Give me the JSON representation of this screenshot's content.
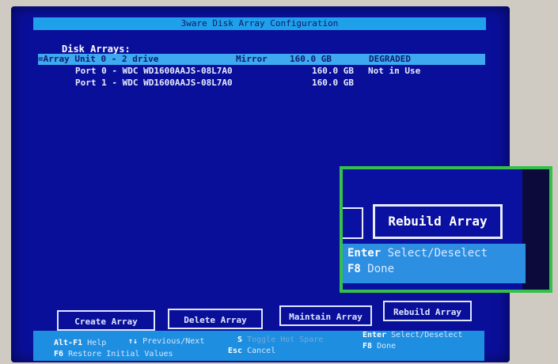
{
  "window": {
    "title": "3ware Disk Array Configuration"
  },
  "section_label": "Disk Arrays:",
  "arrays": [
    {
      "label": "=Array Unit 0 - 2 drive",
      "type": "Mirror",
      "size": "160.0 GB",
      "status": "DEGRADED",
      "selected": true
    },
    {
      "label": "Port 0 - WDC WD1600AAJS-08L7A0",
      "type": "",
      "size": "160.0 GB",
      "status": "Not in Use",
      "selected": false
    },
    {
      "label": "Port 1 - WDC WD1600AAJS-08L7A0",
      "type": "",
      "size": "160.0 GB",
      "status": "",
      "selected": false
    }
  ],
  "buttons": {
    "create": "Create Array",
    "delete": "Delete Array",
    "maintain": "Maintain Array",
    "rebuild": "Rebuild  Array"
  },
  "footer": {
    "alt_f1_key": "Alt-F1",
    "alt_f1_text": "Help",
    "arrows_key": "↑↓",
    "arrows_text": "Previous/Next",
    "space_key": "S",
    "space_text": "Toggle Hot Spare",
    "enter_key": "Enter",
    "enter_text": "Select/Deselect",
    "f6_key": "F6",
    "f6_text": "Restore Initial Values",
    "esc_key": "Esc",
    "esc_text": "Cancel",
    "f8_key": "F8",
    "f8_text": "Done"
  },
  "zoom": {
    "button": "Rebuild  Array",
    "enter_key": "Enter",
    "enter_text": "Select/Deselect",
    "f8_key": "F8",
    "f8_text": "Done"
  },
  "colors": {
    "screen": "#0a0f9a",
    "title_bar": "#1ea1ea",
    "selection": "#3ea8f0",
    "highlight_border": "#34c04a"
  }
}
